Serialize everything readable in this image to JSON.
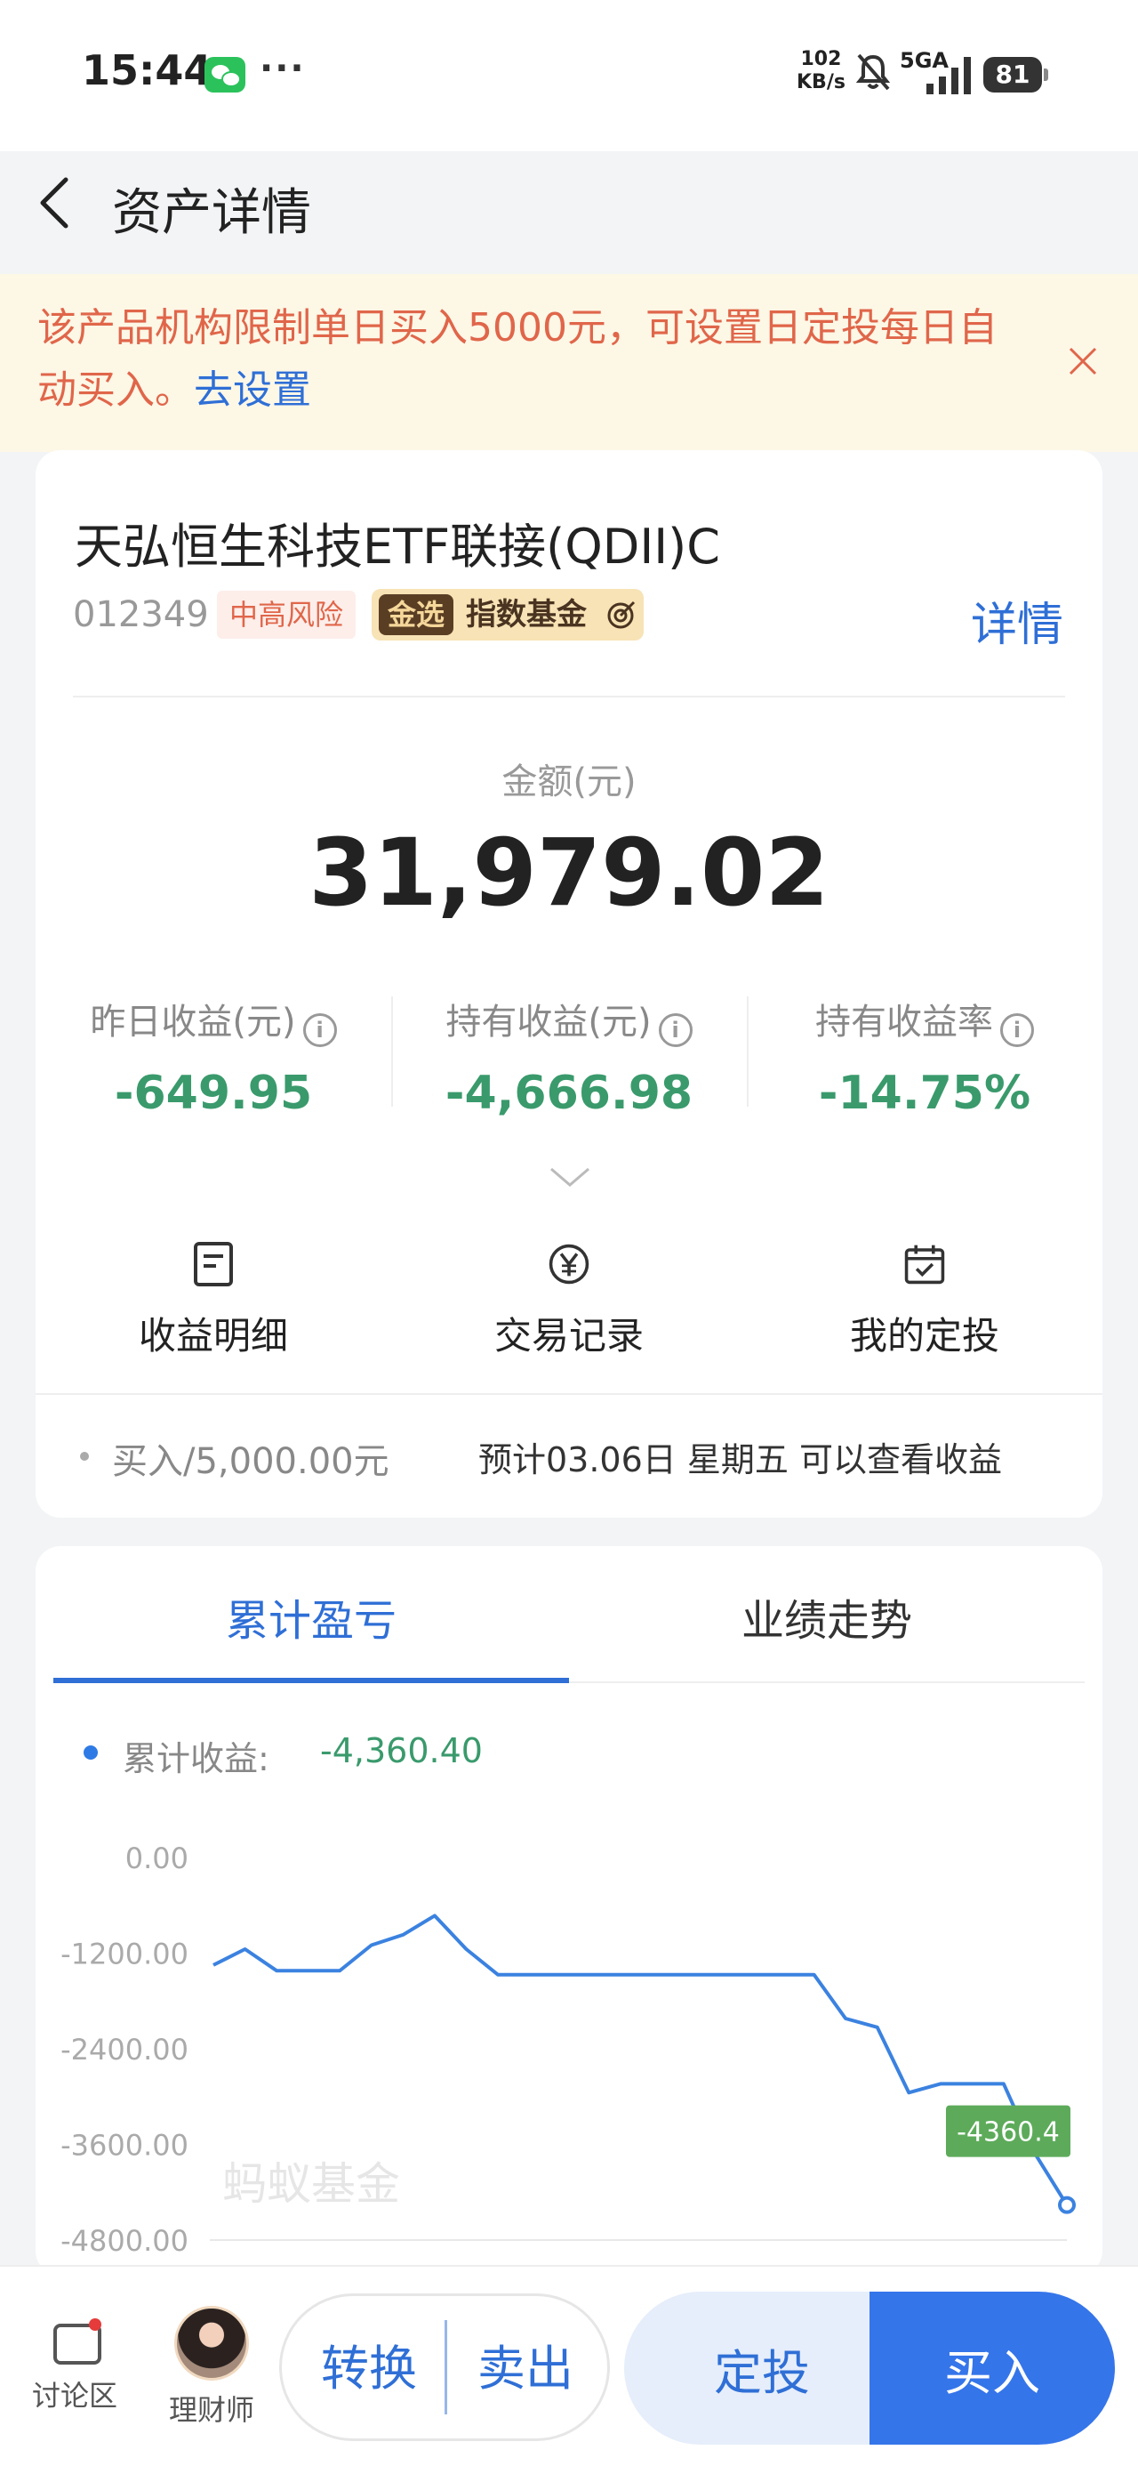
{
  "status_bar": {
    "time": "15:44",
    "net_speed_value": "102",
    "net_speed_unit": "KB/s",
    "signal": "5GA",
    "battery": "81"
  },
  "header": {
    "title": "资产详情"
  },
  "notice": {
    "text": "该产品机构限制单日买入5000元，可设置日定投每日自动买入。",
    "link": "去设置"
  },
  "fund": {
    "name": "天弘恒生科技ETF联接(QDII)C",
    "code": "012349",
    "risk": "中高风险",
    "badge_prefix": "金选",
    "badge_text": "指数基金",
    "detail_link": "详情"
  },
  "amount": {
    "label": "金额(元)",
    "value": "31,979.02"
  },
  "metrics": [
    {
      "label": "昨日收益(元)",
      "value": "-649.95"
    },
    {
      "label": "持有收益(元)",
      "value": "-4,666.98"
    },
    {
      "label": "持有收益率",
      "value": "-14.75%"
    }
  ],
  "actions": [
    {
      "label": "收益明细",
      "icon": "document-icon"
    },
    {
      "label": "交易记录",
      "icon": "yen-icon"
    },
    {
      "label": "我的定投",
      "icon": "calendar-icon"
    }
  ],
  "transaction": {
    "left": "买入/5,000.00元",
    "right": "预计03.06日 星期五 可以查看收益"
  },
  "tabs": [
    {
      "label": "累计盈亏",
      "active": true
    },
    {
      "label": "业绩走势",
      "active": false
    }
  ],
  "legend": {
    "label": "累计收益:",
    "value": "-4,360.40"
  },
  "colors": {
    "accent": "#2f6fd6",
    "loss_green": "#3a9a6c",
    "warning": "#e0664a",
    "line": "#3b82e0"
  },
  "chart_data": {
    "type": "line",
    "ylim": [
      -4800,
      0
    ],
    "yticks": [
      "0.00",
      "-1200.00",
      "-2400.00",
      "-3600.00",
      "-4800.00"
    ],
    "series": [
      {
        "values": [
          -1350,
          -1150,
          -1420,
          -1420,
          -1420,
          -1100,
          -970,
          -730,
          -1150,
          -1470,
          -1470,
          -1470,
          -1470,
          -1470,
          -1470,
          -1470,
          -1470,
          -1470,
          -1470,
          -1470,
          -2020,
          -2130,
          -2950,
          -2840,
          -2840,
          -2840,
          -3720,
          -4360.4
        ]
      }
    ],
    "end_label": "-4360.4",
    "watermark": "蚂蚁基金"
  },
  "bottom_bar": {
    "discuss": "讨论区",
    "advisor": "理财师",
    "convert": "转换",
    "sell": "卖出",
    "fixed_invest": "定投",
    "buy": "买入"
  }
}
